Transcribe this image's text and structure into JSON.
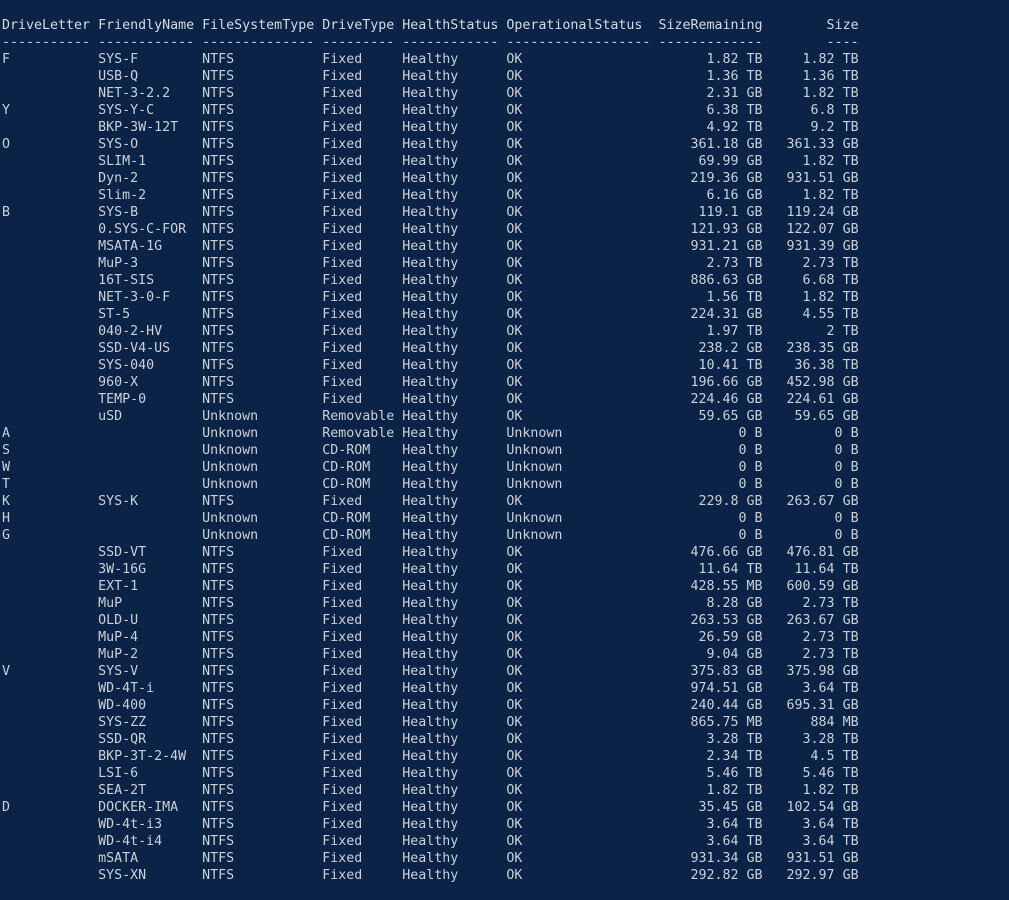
{
  "window": {
    "kind": "powershell-console",
    "background_color": "#0a2347",
    "foreground_color": "#ccd0d8"
  },
  "table": {
    "columns": [
      {
        "key": "DriveLetter",
        "label": "DriveLetter",
        "width": 11,
        "align": "left",
        "rule": "-----------"
      },
      {
        "key": "FriendlyName",
        "label": "FriendlyName",
        "width": 12,
        "align": "left",
        "rule": "------------"
      },
      {
        "key": "FileSystemType",
        "label": "FileSystemType",
        "width": 14,
        "align": "left",
        "rule": "--------------"
      },
      {
        "key": "DriveType",
        "label": "DriveType",
        "width": 9,
        "align": "left",
        "rule": "---------"
      },
      {
        "key": "HealthStatus",
        "label": "HealthStatus",
        "width": 12,
        "align": "left",
        "rule": "------------"
      },
      {
        "key": "OperationalStatus",
        "label": "OperationalStatus",
        "width": 18,
        "align": "left",
        "rule": "------------------"
      },
      {
        "key": "SizeRemaining",
        "label": "SizeRemaining",
        "width": 13,
        "align": "right",
        "rule": "-------------"
      },
      {
        "key": "Size",
        "label": "Size",
        "width": 11,
        "align": "right",
        "rule": "----"
      }
    ],
    "rows": [
      {
        "DriveLetter": "F",
        "FriendlyName": "SYS-F",
        "FileSystemType": "NTFS",
        "DriveType": "Fixed",
        "HealthStatus": "Healthy",
        "OperationalStatus": "OK",
        "SizeRemaining": "1.82 TB",
        "Size": "1.82 TB"
      },
      {
        "DriveLetter": "",
        "FriendlyName": "USB-Q",
        "FileSystemType": "NTFS",
        "DriveType": "Fixed",
        "HealthStatus": "Healthy",
        "OperationalStatus": "OK",
        "SizeRemaining": "1.36 TB",
        "Size": "1.36 TB"
      },
      {
        "DriveLetter": "",
        "FriendlyName": "NET-3-2.2",
        "FileSystemType": "NTFS",
        "DriveType": "Fixed",
        "HealthStatus": "Healthy",
        "OperationalStatus": "OK",
        "SizeRemaining": "2.31 GB",
        "Size": "1.82 TB"
      },
      {
        "DriveLetter": "Y",
        "FriendlyName": "SYS-Y-C",
        "FileSystemType": "NTFS",
        "DriveType": "Fixed",
        "HealthStatus": "Healthy",
        "OperationalStatus": "OK",
        "SizeRemaining": "6.38 TB",
        "Size": "6.8 TB"
      },
      {
        "DriveLetter": "",
        "FriendlyName": "BKP-3W-12T",
        "FileSystemType": "NTFS",
        "DriveType": "Fixed",
        "HealthStatus": "Healthy",
        "OperationalStatus": "OK",
        "SizeRemaining": "4.92 TB",
        "Size": "9.2 TB"
      },
      {
        "DriveLetter": "O",
        "FriendlyName": "SYS-O",
        "FileSystemType": "NTFS",
        "DriveType": "Fixed",
        "HealthStatus": "Healthy",
        "OperationalStatus": "OK",
        "SizeRemaining": "361.18 GB",
        "Size": "361.33 GB"
      },
      {
        "DriveLetter": "",
        "FriendlyName": "SLIM-1",
        "FileSystemType": "NTFS",
        "DriveType": "Fixed",
        "HealthStatus": "Healthy",
        "OperationalStatus": "OK",
        "SizeRemaining": "69.99 GB",
        "Size": "1.82 TB"
      },
      {
        "DriveLetter": "",
        "FriendlyName": "Dyn-2",
        "FileSystemType": "NTFS",
        "DriveType": "Fixed",
        "HealthStatus": "Healthy",
        "OperationalStatus": "OK",
        "SizeRemaining": "219.36 GB",
        "Size": "931.51 GB"
      },
      {
        "DriveLetter": "",
        "FriendlyName": "Slim-2",
        "FileSystemType": "NTFS",
        "DriveType": "Fixed",
        "HealthStatus": "Healthy",
        "OperationalStatus": "OK",
        "SizeRemaining": "6.16 GB",
        "Size": "1.82 TB"
      },
      {
        "DriveLetter": "B",
        "FriendlyName": "SYS-B",
        "FileSystemType": "NTFS",
        "DriveType": "Fixed",
        "HealthStatus": "Healthy",
        "OperationalStatus": "OK",
        "SizeRemaining": "119.1 GB",
        "Size": "119.24 GB"
      },
      {
        "DriveLetter": "",
        "FriendlyName": "0.SYS-C-FOR",
        "FileSystemType": "NTFS",
        "DriveType": "Fixed",
        "HealthStatus": "Healthy",
        "OperationalStatus": "OK",
        "SizeRemaining": "121.93 GB",
        "Size": "122.07 GB"
      },
      {
        "DriveLetter": "",
        "FriendlyName": "MSATA-1G",
        "FileSystemType": "NTFS",
        "DriveType": "Fixed",
        "HealthStatus": "Healthy",
        "OperationalStatus": "OK",
        "SizeRemaining": "931.21 GB",
        "Size": "931.39 GB"
      },
      {
        "DriveLetter": "",
        "FriendlyName": "MuP-3",
        "FileSystemType": "NTFS",
        "DriveType": "Fixed",
        "HealthStatus": "Healthy",
        "OperationalStatus": "OK",
        "SizeRemaining": "2.73 TB",
        "Size": "2.73 TB"
      },
      {
        "DriveLetter": "",
        "FriendlyName": "16T-SIS",
        "FileSystemType": "NTFS",
        "DriveType": "Fixed",
        "HealthStatus": "Healthy",
        "OperationalStatus": "OK",
        "SizeRemaining": "886.63 GB",
        "Size": "6.68 TB"
      },
      {
        "DriveLetter": "",
        "FriendlyName": "NET-3-0-F",
        "FileSystemType": "NTFS",
        "DriveType": "Fixed",
        "HealthStatus": "Healthy",
        "OperationalStatus": "OK",
        "SizeRemaining": "1.56 TB",
        "Size": "1.82 TB"
      },
      {
        "DriveLetter": "",
        "FriendlyName": "ST-5",
        "FileSystemType": "NTFS",
        "DriveType": "Fixed",
        "HealthStatus": "Healthy",
        "OperationalStatus": "OK",
        "SizeRemaining": "224.31 GB",
        "Size": "4.55 TB"
      },
      {
        "DriveLetter": "",
        "FriendlyName": "040-2-HV",
        "FileSystemType": "NTFS",
        "DriveType": "Fixed",
        "HealthStatus": "Healthy",
        "OperationalStatus": "OK",
        "SizeRemaining": "1.97 TB",
        "Size": "2 TB"
      },
      {
        "DriveLetter": "",
        "FriendlyName": "SSD-V4-US",
        "FileSystemType": "NTFS",
        "DriveType": "Fixed",
        "HealthStatus": "Healthy",
        "OperationalStatus": "OK",
        "SizeRemaining": "238.2 GB",
        "Size": "238.35 GB"
      },
      {
        "DriveLetter": "",
        "FriendlyName": "SYS-040",
        "FileSystemType": "NTFS",
        "DriveType": "Fixed",
        "HealthStatus": "Healthy",
        "OperationalStatus": "OK",
        "SizeRemaining": "10.41 TB",
        "Size": "36.38 TB"
      },
      {
        "DriveLetter": "",
        "FriendlyName": "960-X",
        "FileSystemType": "NTFS",
        "DriveType": "Fixed",
        "HealthStatus": "Healthy",
        "OperationalStatus": "OK",
        "SizeRemaining": "196.66 GB",
        "Size": "452.98 GB"
      },
      {
        "DriveLetter": "",
        "FriendlyName": "TEMP-0",
        "FileSystemType": "NTFS",
        "DriveType": "Fixed",
        "HealthStatus": "Healthy",
        "OperationalStatus": "OK",
        "SizeRemaining": "224.46 GB",
        "Size": "224.61 GB"
      },
      {
        "DriveLetter": "",
        "FriendlyName": "uSD",
        "FileSystemType": "Unknown",
        "DriveType": "Removable",
        "HealthStatus": "Healthy",
        "OperationalStatus": "OK",
        "SizeRemaining": "59.65 GB",
        "Size": "59.65 GB"
      },
      {
        "DriveLetter": "A",
        "FriendlyName": "",
        "FileSystemType": "Unknown",
        "DriveType": "Removable",
        "HealthStatus": "Healthy",
        "OperationalStatus": "Unknown",
        "SizeRemaining": "0 B",
        "Size": "0 B"
      },
      {
        "DriveLetter": "S",
        "FriendlyName": "",
        "FileSystemType": "Unknown",
        "DriveType": "CD-ROM",
        "HealthStatus": "Healthy",
        "OperationalStatus": "Unknown",
        "SizeRemaining": "0 B",
        "Size": "0 B"
      },
      {
        "DriveLetter": "W",
        "FriendlyName": "",
        "FileSystemType": "Unknown",
        "DriveType": "CD-ROM",
        "HealthStatus": "Healthy",
        "OperationalStatus": "Unknown",
        "SizeRemaining": "0 B",
        "Size": "0 B"
      },
      {
        "DriveLetter": "T",
        "FriendlyName": "",
        "FileSystemType": "Unknown",
        "DriveType": "CD-ROM",
        "HealthStatus": "Healthy",
        "OperationalStatus": "Unknown",
        "SizeRemaining": "0 B",
        "Size": "0 B"
      },
      {
        "DriveLetter": "K",
        "FriendlyName": "SYS-K",
        "FileSystemType": "NTFS",
        "DriveType": "Fixed",
        "HealthStatus": "Healthy",
        "OperationalStatus": "OK",
        "SizeRemaining": "229.8 GB",
        "Size": "263.67 GB"
      },
      {
        "DriveLetter": "H",
        "FriendlyName": "",
        "FileSystemType": "Unknown",
        "DriveType": "CD-ROM",
        "HealthStatus": "Healthy",
        "OperationalStatus": "Unknown",
        "SizeRemaining": "0 B",
        "Size": "0 B"
      },
      {
        "DriveLetter": "G",
        "FriendlyName": "",
        "FileSystemType": "Unknown",
        "DriveType": "CD-ROM",
        "HealthStatus": "Healthy",
        "OperationalStatus": "Unknown",
        "SizeRemaining": "0 B",
        "Size": "0 B"
      },
      {
        "DriveLetter": "",
        "FriendlyName": "SSD-VT",
        "FileSystemType": "NTFS",
        "DriveType": "Fixed",
        "HealthStatus": "Healthy",
        "OperationalStatus": "OK",
        "SizeRemaining": "476.66 GB",
        "Size": "476.81 GB"
      },
      {
        "DriveLetter": "",
        "FriendlyName": "3W-16G",
        "FileSystemType": "NTFS",
        "DriveType": "Fixed",
        "HealthStatus": "Healthy",
        "OperationalStatus": "OK",
        "SizeRemaining": "11.64 TB",
        "Size": "11.64 TB"
      },
      {
        "DriveLetter": "",
        "FriendlyName": "EXT-1",
        "FileSystemType": "NTFS",
        "DriveType": "Fixed",
        "HealthStatus": "Healthy",
        "OperationalStatus": "OK",
        "SizeRemaining": "428.55 MB",
        "Size": "600.59 GB"
      },
      {
        "DriveLetter": "",
        "FriendlyName": "MuP",
        "FileSystemType": "NTFS",
        "DriveType": "Fixed",
        "HealthStatus": "Healthy",
        "OperationalStatus": "OK",
        "SizeRemaining": "8.28 GB",
        "Size": "2.73 TB"
      },
      {
        "DriveLetter": "",
        "FriendlyName": "OLD-U",
        "FileSystemType": "NTFS",
        "DriveType": "Fixed",
        "HealthStatus": "Healthy",
        "OperationalStatus": "OK",
        "SizeRemaining": "263.53 GB",
        "Size": "263.67 GB"
      },
      {
        "DriveLetter": "",
        "FriendlyName": "MuP-4",
        "FileSystemType": "NTFS",
        "DriveType": "Fixed",
        "HealthStatus": "Healthy",
        "OperationalStatus": "OK",
        "SizeRemaining": "26.59 GB",
        "Size": "2.73 TB"
      },
      {
        "DriveLetter": "",
        "FriendlyName": "MuP-2",
        "FileSystemType": "NTFS",
        "DriveType": "Fixed",
        "HealthStatus": "Healthy",
        "OperationalStatus": "OK",
        "SizeRemaining": "9.04 GB",
        "Size": "2.73 TB"
      },
      {
        "DriveLetter": "V",
        "FriendlyName": "SYS-V",
        "FileSystemType": "NTFS",
        "DriveType": "Fixed",
        "HealthStatus": "Healthy",
        "OperationalStatus": "OK",
        "SizeRemaining": "375.83 GB",
        "Size": "375.98 GB"
      },
      {
        "DriveLetter": "",
        "FriendlyName": "WD-4T-i",
        "FileSystemType": "NTFS",
        "DriveType": "Fixed",
        "HealthStatus": "Healthy",
        "OperationalStatus": "OK",
        "SizeRemaining": "974.51 GB",
        "Size": "3.64 TB"
      },
      {
        "DriveLetter": "",
        "FriendlyName": "WD-400",
        "FileSystemType": "NTFS",
        "DriveType": "Fixed",
        "HealthStatus": "Healthy",
        "OperationalStatus": "OK",
        "SizeRemaining": "240.44 GB",
        "Size": "695.31 GB"
      },
      {
        "DriveLetter": "",
        "FriendlyName": "SYS-ZZ",
        "FileSystemType": "NTFS",
        "DriveType": "Fixed",
        "HealthStatus": "Healthy",
        "OperationalStatus": "OK",
        "SizeRemaining": "865.75 MB",
        "Size": "884 MB"
      },
      {
        "DriveLetter": "",
        "FriendlyName": "SSD-QR",
        "FileSystemType": "NTFS",
        "DriveType": "Fixed",
        "HealthStatus": "Healthy",
        "OperationalStatus": "OK",
        "SizeRemaining": "3.28 TB",
        "Size": "3.28 TB"
      },
      {
        "DriveLetter": "",
        "FriendlyName": "BKP-3T-2-4W",
        "FileSystemType": "NTFS",
        "DriveType": "Fixed",
        "HealthStatus": "Healthy",
        "OperationalStatus": "OK",
        "SizeRemaining": "2.34 TB",
        "Size": "4.5 TB"
      },
      {
        "DriveLetter": "",
        "FriendlyName": "LSI-6",
        "FileSystemType": "NTFS",
        "DriveType": "Fixed",
        "HealthStatus": "Healthy",
        "OperationalStatus": "OK",
        "SizeRemaining": "5.46 TB",
        "Size": "5.46 TB"
      },
      {
        "DriveLetter": "",
        "FriendlyName": "SEA-2T",
        "FileSystemType": "NTFS",
        "DriveType": "Fixed",
        "HealthStatus": "Healthy",
        "OperationalStatus": "OK",
        "SizeRemaining": "1.82 TB",
        "Size": "1.82 TB"
      },
      {
        "DriveLetter": "D",
        "FriendlyName": "DOCKER-IMA",
        "FileSystemType": "NTFS",
        "DriveType": "Fixed",
        "HealthStatus": "Healthy",
        "OperationalStatus": "OK",
        "SizeRemaining": "35.45 GB",
        "Size": "102.54 GB"
      },
      {
        "DriveLetter": "",
        "FriendlyName": "WD-4t-i3",
        "FileSystemType": "NTFS",
        "DriveType": "Fixed",
        "HealthStatus": "Healthy",
        "OperationalStatus": "OK",
        "SizeRemaining": "3.64 TB",
        "Size": "3.64 TB"
      },
      {
        "DriveLetter": "",
        "FriendlyName": "WD-4t-i4",
        "FileSystemType": "NTFS",
        "DriveType": "Fixed",
        "HealthStatus": "Healthy",
        "OperationalStatus": "OK",
        "SizeRemaining": "3.64 TB",
        "Size": "3.64 TB"
      },
      {
        "DriveLetter": "",
        "FriendlyName": "mSATA",
        "FileSystemType": "NTFS",
        "DriveType": "Fixed",
        "HealthStatus": "Healthy",
        "OperationalStatus": "OK",
        "SizeRemaining": "931.34 GB",
        "Size": "931.51 GB"
      },
      {
        "DriveLetter": "",
        "FriendlyName": "SYS-XN",
        "FileSystemType": "NTFS",
        "DriveType": "Fixed",
        "HealthStatus": "Healthy",
        "OperationalStatus": "OK",
        "SizeRemaining": "292.82 GB",
        "Size": "292.97 GB"
      }
    ]
  }
}
